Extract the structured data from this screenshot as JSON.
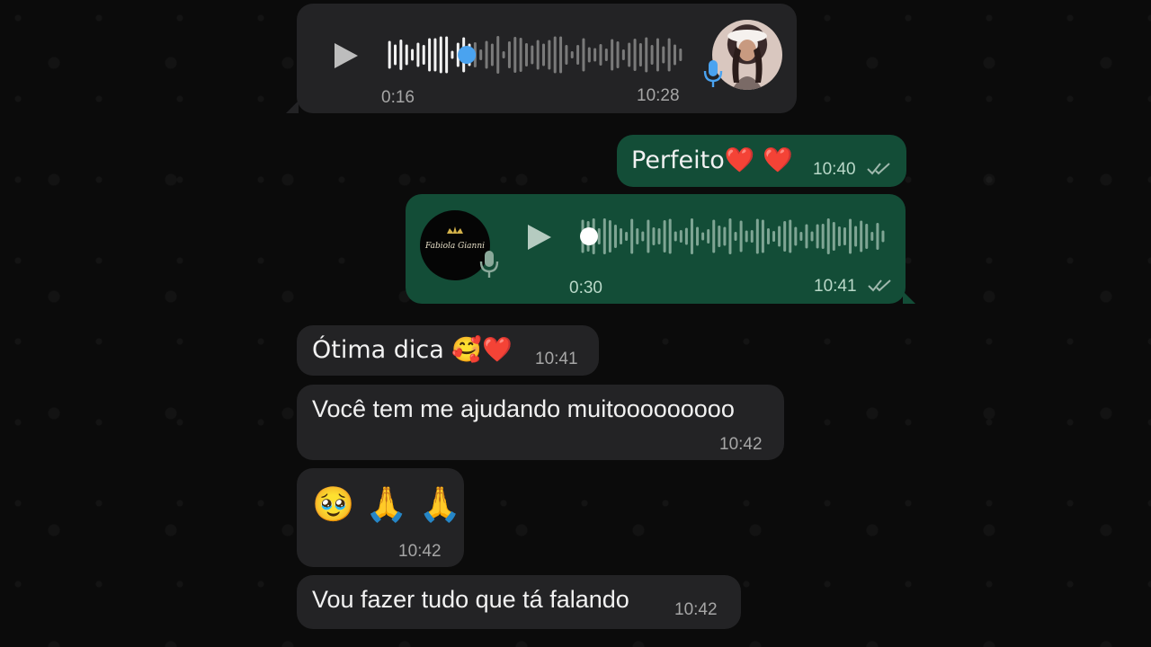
{
  "chat": {
    "messages": [
      {
        "type": "voice",
        "direction": "incoming",
        "duration": "0:16",
        "time": "10:28",
        "progress": 0.27
      },
      {
        "type": "text",
        "direction": "outgoing",
        "text": "Perfeito❤️ ❤️",
        "time": "10:40",
        "status": "read"
      },
      {
        "type": "voice",
        "direction": "outgoing",
        "duration": "0:30",
        "time": "10:41",
        "status": "read",
        "progress": 0.0,
        "avatar_text": "Fabiola Gianni"
      },
      {
        "type": "text",
        "direction": "incoming",
        "text": "Ótima dica 🥰❤️",
        "time": "10:41"
      },
      {
        "type": "text",
        "direction": "incoming",
        "text": "Você tem me ajudando muitooooooooo",
        "time": "10:42"
      },
      {
        "type": "text",
        "direction": "incoming",
        "text": "🥹 🙏 🙏",
        "time": "10:42"
      },
      {
        "type": "text",
        "direction": "incoming",
        "text": "Vou fazer tudo que tá falando",
        "time": "10:42"
      }
    ]
  },
  "colors": {
    "incoming_bubble": "#232325",
    "outgoing_bubble": "#134d37",
    "progress_dot_incoming": "#4aa3f0",
    "mic_icon_incoming": "#4aa3f0"
  }
}
